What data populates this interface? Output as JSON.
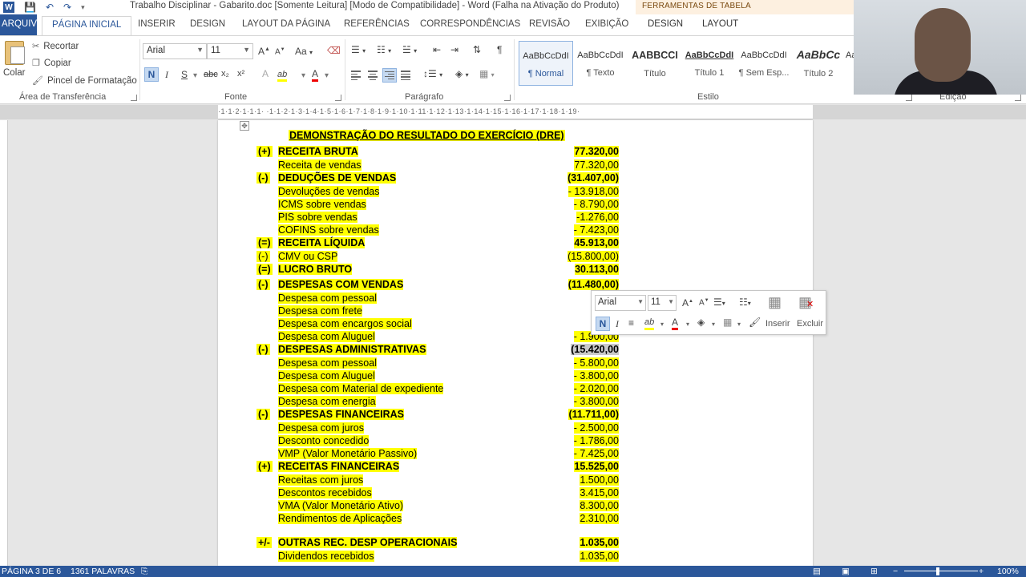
{
  "title_bar": {
    "document_title": "Trabalho Disciplinar - Gabarito.doc [Somente Leitura] [Modo de Compatibilidade] - Word (Falha na Ativação do Produto)",
    "contextual_group": "FERRAMENTAS DE TABELA",
    "qat_icons": [
      "word-logo",
      "save-icon",
      "undo-icon",
      "redo-icon",
      "customize-icon"
    ]
  },
  "tabs": {
    "file": "ARQUIVO",
    "home": "PÁGINA INICIAL",
    "insert": "INSERIR",
    "design": "DESIGN",
    "layout_page": "LAYOUT DA PÁGINA",
    "references": "REFERÊNCIAS",
    "mailings": "CORRESPONDÊNCIAS",
    "review": "REVISÃO",
    "view": "EXIBIÇÃO",
    "table_design": "DESIGN",
    "table_layout": "LAYOUT"
  },
  "ribbon": {
    "clipboard": {
      "paste": "Colar",
      "cut": "Recortar",
      "copy": "Copiar",
      "format_painter": "Pincel de Formatação",
      "label": "Área de Transferência"
    },
    "font": {
      "font_name": "Arial",
      "font_size": "11",
      "bold": "N",
      "italic": "I",
      "underline": "S",
      "strike": "abc",
      "subscript": "x₂",
      "superscript": "x²",
      "grow": "A",
      "shrink": "A",
      "case": "Aa",
      "highlight": "ab",
      "color": "A",
      "label": "Fonte"
    },
    "paragraph": {
      "label": "Parágrafo",
      "show_marks": "¶"
    },
    "styles": {
      "label": "Estilo",
      "items": [
        {
          "preview": "AaBbCcDdI",
          "name": "¶ Normal"
        },
        {
          "preview": "AaBbCcDdI",
          "name": "¶ Texto"
        },
        {
          "preview": "AABBCCI",
          "name": "Título"
        },
        {
          "preview": "AaBbCcDdI",
          "name": "Título 1"
        },
        {
          "preview": "AaBbCcDdI",
          "name": "¶ Sem Esp..."
        },
        {
          "preview": "AaBbCc",
          "name": "Título 2"
        },
        {
          "preview": "Aa",
          "name": ""
        }
      ]
    },
    "editing": {
      "label": "Edição"
    }
  },
  "ruler": {
    "numbers": "·1·1·2·1·1·1·  ·1·1·2·1·3·1·4·1·5·1·6·1·7·1·8·1·9·1·10·1·11·1·12·1·13·1·14·1·15·1·16·1·17·1·18·1·19·"
  },
  "document": {
    "heading": "DEMONSTRAÇÃO DO RESULTADO DO EXERCÍCIO (DRE)",
    "rows": [
      {
        "sign": "(+)",
        "desc": "RECEITA BRUTA",
        "value": "77.320,00",
        "header": true
      },
      {
        "sign": "",
        "desc": "Receita de vendas",
        "value": "77.320,00",
        "header": false
      },
      {
        "sign": "(-)",
        "desc": "DEDUÇÕES DE VENDAS",
        "value": "(31.407,00)",
        "header": true
      },
      {
        "sign": "",
        "desc": "Devoluções de vendas",
        "value": "- 13.918,00",
        "header": false
      },
      {
        "sign": "",
        "desc": "ICMS sobre vendas",
        "value": "- 8.790,00",
        "header": false
      },
      {
        "sign": "",
        "desc": "PIS sobre vendas",
        "value": "-1.276,00",
        "header": false
      },
      {
        "sign": "",
        "desc": "COFINS sobre vendas",
        "value": "- 7.423,00",
        "header": false
      },
      {
        "sign": "(=)",
        "desc": "RECEITA LÍQUIDA",
        "value": "45.913,00",
        "header": true
      },
      {
        "sign": "(-)",
        "desc": "CMV ou CSP",
        "value": "(15.800,00)",
        "header": false
      },
      {
        "sign": "(=)",
        "desc": "LUCRO BRUTO",
        "value": "30.113,00",
        "header": true
      },
      {
        "sign": "(-)",
        "desc": "DESPESAS COM VENDAS",
        "value": "(11.480,00)",
        "header": true
      },
      {
        "sign": "",
        "desc": "Despesa com pessoal",
        "value": "- 4.2",
        "header": false
      },
      {
        "sign": "",
        "desc": "Despesa com frete",
        "value": "- 3.0",
        "header": false
      },
      {
        "sign": "",
        "desc": "Despesa com encargos social",
        "value": "- 2.3",
        "header": false
      },
      {
        "sign": "",
        "desc": "Despesa com Aluguel",
        "value": "- 1.900,00",
        "header": false
      },
      {
        "sign": "(-)",
        "desc": "DESPESAS ADMINISTRATIVAS",
        "value": "(15.420,00",
        "header": true,
        "selected": true
      },
      {
        "sign": "",
        "desc": "Despesa com pessoal",
        "value": "- 5.800,00",
        "header": false
      },
      {
        "sign": "",
        "desc": "Despesa com Aluguel",
        "value": "- 3.800,00",
        "header": false
      },
      {
        "sign": "",
        "desc": "Despesa com Material de expediente",
        "value": "- 2.020,00",
        "header": false
      },
      {
        "sign": "",
        "desc": "Despesa com energia",
        "value": "- 3.800,00",
        "header": false
      },
      {
        "sign": "(-)",
        "desc": "DESPESAS FINANCEIRAS",
        "value": "(11.711,00)",
        "header": true
      },
      {
        "sign": "",
        "desc": "Despesa com juros",
        "value": "- 2.500,00",
        "header": false
      },
      {
        "sign": "",
        "desc": "Desconto concedido",
        "value": "- 1.786,00",
        "header": false
      },
      {
        "sign": "",
        "desc": "VMP (Valor Monetário Passivo)",
        "value": "- 7.425,00",
        "header": false
      },
      {
        "sign": "(+)",
        "desc": "RECEITAS FINANCEIRAS",
        "value": "15.525,00",
        "header": true
      },
      {
        "sign": "",
        "desc": "Receitas com juros",
        "value": "1.500,00",
        "header": false
      },
      {
        "sign": "",
        "desc": "Descontos recebidos",
        "value": "3.415,00",
        "header": false
      },
      {
        "sign": "",
        "desc": "VMA (Valor Monetário Ativo)",
        "value": "8.300,00",
        "header": false
      },
      {
        "sign": "",
        "desc": "Rendimentos de Aplicações",
        "value": "2.310,00",
        "header": false
      },
      {
        "sign": "+/-",
        "desc": "OUTRAS REC. DESP OPERACIONAIS",
        "value": "1.035,00",
        "header": true
      },
      {
        "sign": "",
        "desc": "Dividendos recebidos",
        "value": "1.035,00",
        "header": false
      }
    ]
  },
  "mini_toolbar": {
    "font_name": "Arial",
    "font_size": "11",
    "bold": "N",
    "italic": "I",
    "insert_label": "Inserir",
    "delete_label": "Excluir"
  },
  "status_bar": {
    "page": "PÁGINA 3 DE 6",
    "words": "1361 PALAVRAS",
    "zoom": "100%"
  },
  "colors": {
    "accent": "#2b579a",
    "highlight": "#ffff00",
    "tools_band": "#fdf0e0"
  }
}
